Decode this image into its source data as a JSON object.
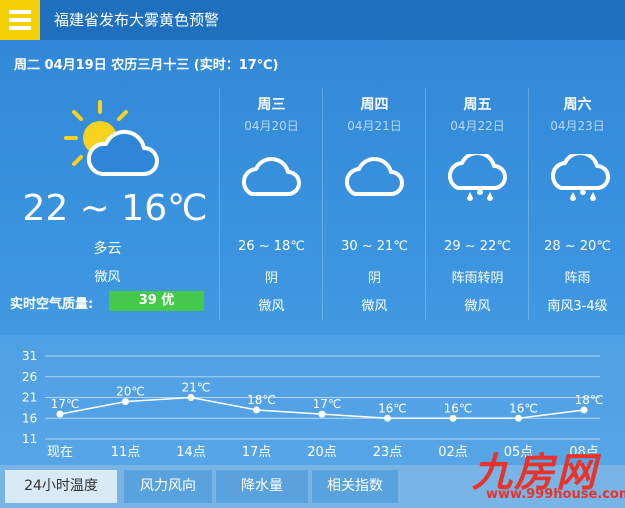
{
  "header": {
    "alert_title": "福建省发布大雾黄色预警"
  },
  "date_line": "周二 04月19日 农历三月十三 (实时：17℃)",
  "today": {
    "temp": "22 ~ 16℃",
    "condition": "多云",
    "wind": "微风",
    "icon": "sun-cloud-icon",
    "aqi_label": "实时空气质量:",
    "aqi_value": "39 优",
    "aqi_color": "#45c94a"
  },
  "forecast": [
    {
      "day": "周三",
      "date": "04月20日",
      "temp": "26 ~ 18℃",
      "condition": "阴",
      "wind": "微风",
      "icon": "cloud-icon"
    },
    {
      "day": "周四",
      "date": "04月21日",
      "temp": "30 ~ 21℃",
      "condition": "阴",
      "wind": "微风",
      "icon": "cloud-icon"
    },
    {
      "day": "周五",
      "date": "04月22日",
      "temp": "29 ~ 22℃",
      "condition": "阵雨转阴",
      "wind": "微风",
      "icon": "rain-cloud-icon"
    },
    {
      "day": "周六",
      "date": "04月23日",
      "temp": "28 ~ 20℃",
      "condition": "阵雨",
      "wind": "南风3-4级",
      "icon": "rain-cloud-icon"
    }
  ],
  "chart_data": {
    "type": "line",
    "categories": [
      "现在",
      "11点",
      "14点",
      "17点",
      "20点",
      "23点",
      "02点",
      "05点",
      "08点"
    ],
    "values": [
      17,
      20,
      21,
      18,
      17,
      16,
      16,
      16,
      18
    ],
    "point_labels": [
      "17℃",
      "20℃",
      "21℃",
      "18℃",
      "17℃",
      "16℃",
      "16℃",
      "16℃",
      "18℃"
    ],
    "y_ticks": [
      31,
      26,
      21,
      16,
      11
    ],
    "ylim": [
      11,
      31
    ],
    "grid": true
  },
  "tabs": [
    {
      "label": "24小时温度",
      "active": true
    },
    {
      "label": "风力风向",
      "active": false
    },
    {
      "label": "降水量",
      "active": false
    },
    {
      "label": "相关指数",
      "active": false
    }
  ],
  "watermark": {
    "text": "九房网",
    "url": "www.999house.com"
  },
  "colors": {
    "header_bg": "#1f6fbf",
    "menu_bg": "#f5d10a",
    "watermark": "#e8332b"
  }
}
